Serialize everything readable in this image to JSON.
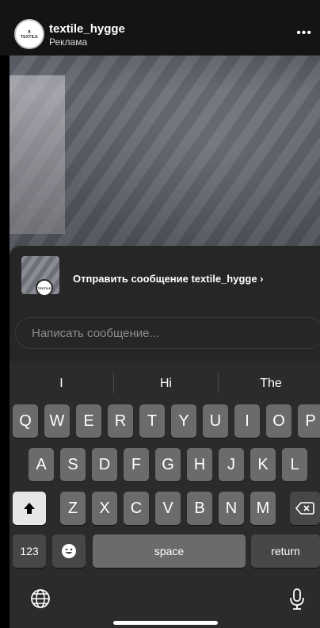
{
  "story": {
    "account_name": "textile_hygge",
    "sponsored_label": "Реклама",
    "more_icon": "more-icon",
    "avatar_top": "ᴥ",
    "avatar_logo": "TEXTILE"
  },
  "message_sheet": {
    "send_link": "Отправить сообщение textile_hygge ›",
    "input_placeholder": "Написать сообщение...",
    "thumb_badge": "TEXTILE"
  },
  "keyboard": {
    "suggestions": [
      "I",
      "Hi",
      "The"
    ],
    "row1": [
      "Q",
      "W",
      "E",
      "R",
      "T",
      "Y",
      "U",
      "I",
      "O",
      "P"
    ],
    "row2": [
      "A",
      "S",
      "D",
      "F",
      "G",
      "H",
      "J",
      "K",
      "L"
    ],
    "row3": [
      "Z",
      "X",
      "C",
      "V",
      "B",
      "N",
      "M"
    ],
    "numbers_key": "123",
    "space_key": "space",
    "return_key": "return",
    "shift_icon": "shift-icon",
    "delete_icon": "delete-icon",
    "emoji_icon": "emoji-icon",
    "globe_icon": "globe-icon",
    "mic_icon": "microphone-icon"
  }
}
